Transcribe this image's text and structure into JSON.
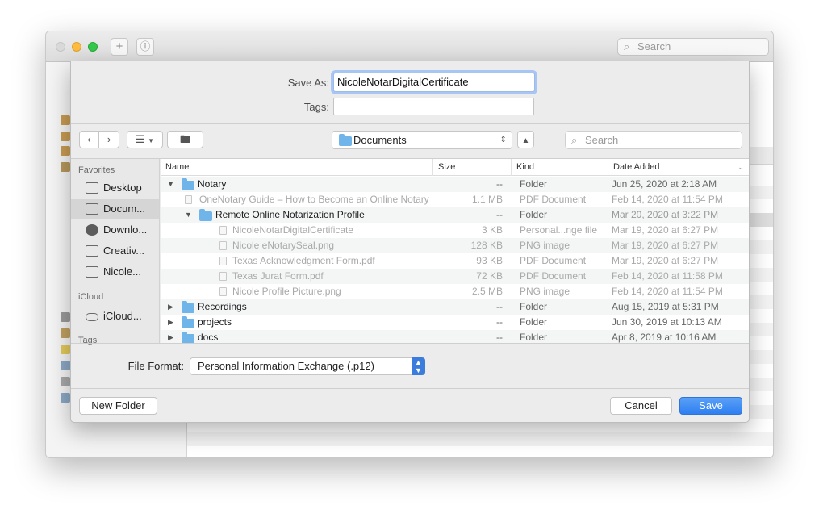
{
  "background_window": {
    "search_placeholder": "Search"
  },
  "save_panel": {
    "save_as_label": "Save As:",
    "save_as_value": "NicoleNotarDigitalCertificate",
    "tags_label": "Tags:",
    "tags_value": "",
    "location": "Documents",
    "search_placeholder": "Search",
    "sidebar": {
      "favorites_heading": "Favorites",
      "favorites": [
        {
          "label": "Desktop",
          "icon": "desktop-icon"
        },
        {
          "label": "Docum...",
          "icon": "documents-icon",
          "selected": true
        },
        {
          "label": "Downlo...",
          "icon": "downloads-icon"
        },
        {
          "label": "Creativ...",
          "icon": "folder-icon"
        },
        {
          "label": "Nicole...",
          "icon": "folder-icon"
        }
      ],
      "icloud_heading": "iCloud",
      "icloud": [
        {
          "label": "iCloud...",
          "icon": "cloud-icon"
        }
      ],
      "tags_heading": "Tags"
    },
    "columns": {
      "name": "Name",
      "size": "Size",
      "kind": "Kind",
      "date_added": "Date Added"
    },
    "rows": [
      {
        "name": "Notary",
        "size": "--",
        "kind": "Folder",
        "date": "Jun 25, 2020 at 2:18 AM"
      },
      {
        "name": "OneNotary Guide – How to Become an Online Notary",
        "size": "1.1 MB",
        "kind": "PDF Document",
        "date": "Feb 14, 2020 at 11:54 PM"
      },
      {
        "name": "Remote Online Notarization Profile",
        "size": "--",
        "kind": "Folder",
        "date": "Mar 20, 2020 at 3:22 PM"
      },
      {
        "name": "NicoleNotarDigitalCertificate",
        "size": "3 KB",
        "kind": "Personal...nge file",
        "date": "Mar 19, 2020 at 6:27 PM"
      },
      {
        "name": "Nicole eNotarySeal.png",
        "size": "128 KB",
        "kind": "PNG image",
        "date": "Mar 19, 2020 at 6:27 PM"
      },
      {
        "name": "Texas Acknowledgment Form.pdf",
        "size": "93 KB",
        "kind": "PDF Document",
        "date": "Mar 19, 2020 at 6:27 PM"
      },
      {
        "name": "Texas Jurat Form.pdf",
        "size": "72 KB",
        "kind": "PDF Document",
        "date": "Feb 14, 2020 at 11:58 PM"
      },
      {
        "name": "Nicole Profile Picture.png",
        "size": "2.5 MB",
        "kind": "PNG image",
        "date": "Feb 14, 2020 at 11:54 PM"
      },
      {
        "name": "Recordings",
        "size": "--",
        "kind": "Folder",
        "date": "Aug 15, 2019 at 5:31 PM"
      },
      {
        "name": "projects",
        "size": "--",
        "kind": "Folder",
        "date": "Jun 30, 2019 at 10:13 AM"
      },
      {
        "name": "docs",
        "size": "--",
        "kind": "Folder",
        "date": "Apr 8, 2019 at 10:16 AM"
      }
    ],
    "file_format_label": "File Format:",
    "file_format_value": "Personal Information Exchange (.p12)",
    "new_folder_label": "New Folder",
    "cancel_label": "Cancel",
    "save_label": "Save"
  }
}
